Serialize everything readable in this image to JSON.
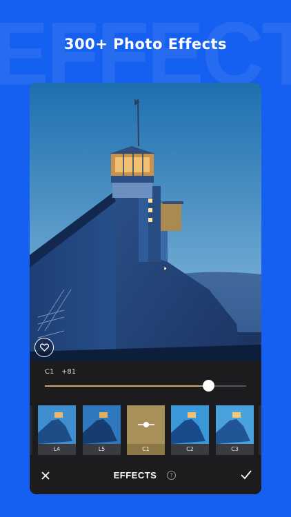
{
  "background_word": "EFFECTS",
  "headline": "300+ Photo Effects",
  "colors": {
    "page_background": "#1560f0",
    "panel": "#1c1c1e",
    "accent_gold": "#c8a968",
    "selected_tile": "#a8905a"
  },
  "slider": {
    "effect_label": "C1",
    "value_label": "+81",
    "level_fraction": 0.81
  },
  "filters": [
    {
      "label": "L4",
      "selected": false
    },
    {
      "label": "L5",
      "selected": false
    },
    {
      "label": "C1",
      "selected": true
    },
    {
      "label": "C2",
      "selected": false
    },
    {
      "label": "C3",
      "selected": false
    }
  ],
  "bottom_bar": {
    "title": "EFFECTS",
    "help_glyph": "?",
    "close_icon": "close-icon",
    "confirm_icon": "checkmark-icon"
  },
  "photo_overlay": {
    "favorite_icon": "heart-icon"
  }
}
